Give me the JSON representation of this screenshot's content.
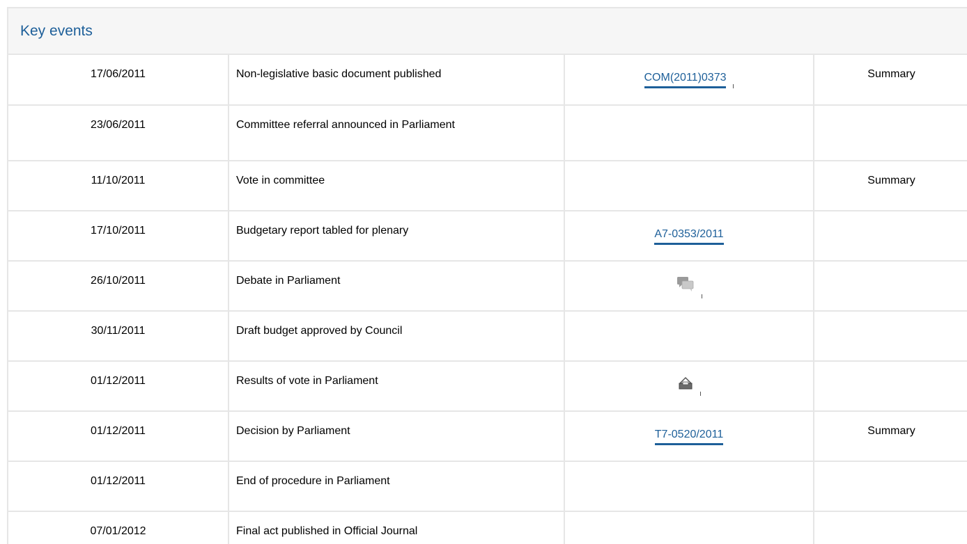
{
  "header": {
    "title": "Key events"
  },
  "rows": [
    {
      "date": "17/06/2011",
      "event": "Non-legislative basic document published",
      "doc": "COM(2011)0373",
      "summary": "Summary"
    },
    {
      "date": "23/06/2011",
      "event": "Committee referral announced in Parliament",
      "doc": "",
      "summary": ""
    },
    {
      "date": "11/10/2011",
      "event": "Vote in committee",
      "doc": "",
      "summary": "Summary"
    },
    {
      "date": "17/10/2011",
      "event": "Budgetary report tabled for plenary",
      "doc": "A7-0353/2011",
      "summary": ""
    },
    {
      "date": "26/10/2011",
      "event": "Debate in Parliament",
      "doc_icon": "debate-icon",
      "summary": ""
    },
    {
      "date": "30/11/2011",
      "event": "Draft budget approved by Council",
      "doc": "",
      "summary": ""
    },
    {
      "date": "01/12/2011",
      "event": "Results of vote in Parliament",
      "doc_icon": "vote-results-icon",
      "summary": ""
    },
    {
      "date": "01/12/2011",
      "event": "Decision by Parliament",
      "doc": "T7-0520/2011",
      "summary": "Summary"
    },
    {
      "date": "01/12/2011",
      "event": "End of procedure in Parliament",
      "doc": "",
      "summary": ""
    },
    {
      "date": "07/01/2012",
      "event": "Final act published in Official Journal",
      "doc": "",
      "summary": ""
    }
  ],
  "colors": {
    "accent": "#1d5f99",
    "border": "#e6e6e6",
    "header_bg": "#f6f6f6"
  }
}
